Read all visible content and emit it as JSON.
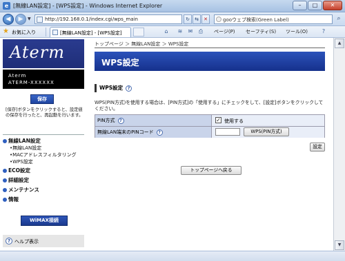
{
  "window": {
    "title": "[無線LAN設定] - [WPS設定] - Windows Internet Explorer",
    "controls": {
      "minimize": "–",
      "maximize": "□",
      "close": "✕"
    }
  },
  "address": {
    "url": "http://192.168.0.1/index.cgi/wps_main",
    "search_text": "gooウェブ検索(Green Label)"
  },
  "favorites": {
    "label": "お気に入り",
    "tab_label": "[無線LAN設定] - [WPS設定]"
  },
  "commandbar": {
    "page": "ページ(P)",
    "safety": "セーフティ(S)",
    "tools": "ツール(O)"
  },
  "sidebar": {
    "logo": "Aterm",
    "device_line1": "Aterm",
    "device_line2": "ATERM-XXXXXX",
    "save_button": "保存",
    "save_note": "[保存]ボタンをクリックすると、設定値の保存を行ったと、再起動を行います。",
    "menu": {
      "wireless": "無線LAN設定",
      "wireless_sub": [
        "無線LAN設定",
        "MACアドレスフィルタリング",
        "WPS設定"
      ],
      "eco": "ECO設定",
      "detail": "詳細設定",
      "maintenance": "メンテナンス",
      "info": "情報"
    },
    "wimax_button": "WiMAX接続",
    "help_label": "ヘルプ表示"
  },
  "main": {
    "breadcrumb": "トップページ ＞ 無線LAN設定 ＞ WPS設定",
    "page_title": "WPS設定",
    "section_title": "WPS設定",
    "description": "WPS(PIN方式)を使用する場合は、[PIN方式]の「使用する」にチェックをして、[設定]ボタンをクリックしてください。",
    "rows": {
      "pin_method_label": "PIN方式",
      "pin_method_checkbox_label": "使用する",
      "pin_method_checked": true,
      "pin_code_label": "無線LAN端末のPINコード",
      "pin_code_value": "",
      "wps_pin_button": "WPS(PIN方式)"
    },
    "settings_button": "設定",
    "back_to_top_button": "トップページへ戻る"
  }
}
